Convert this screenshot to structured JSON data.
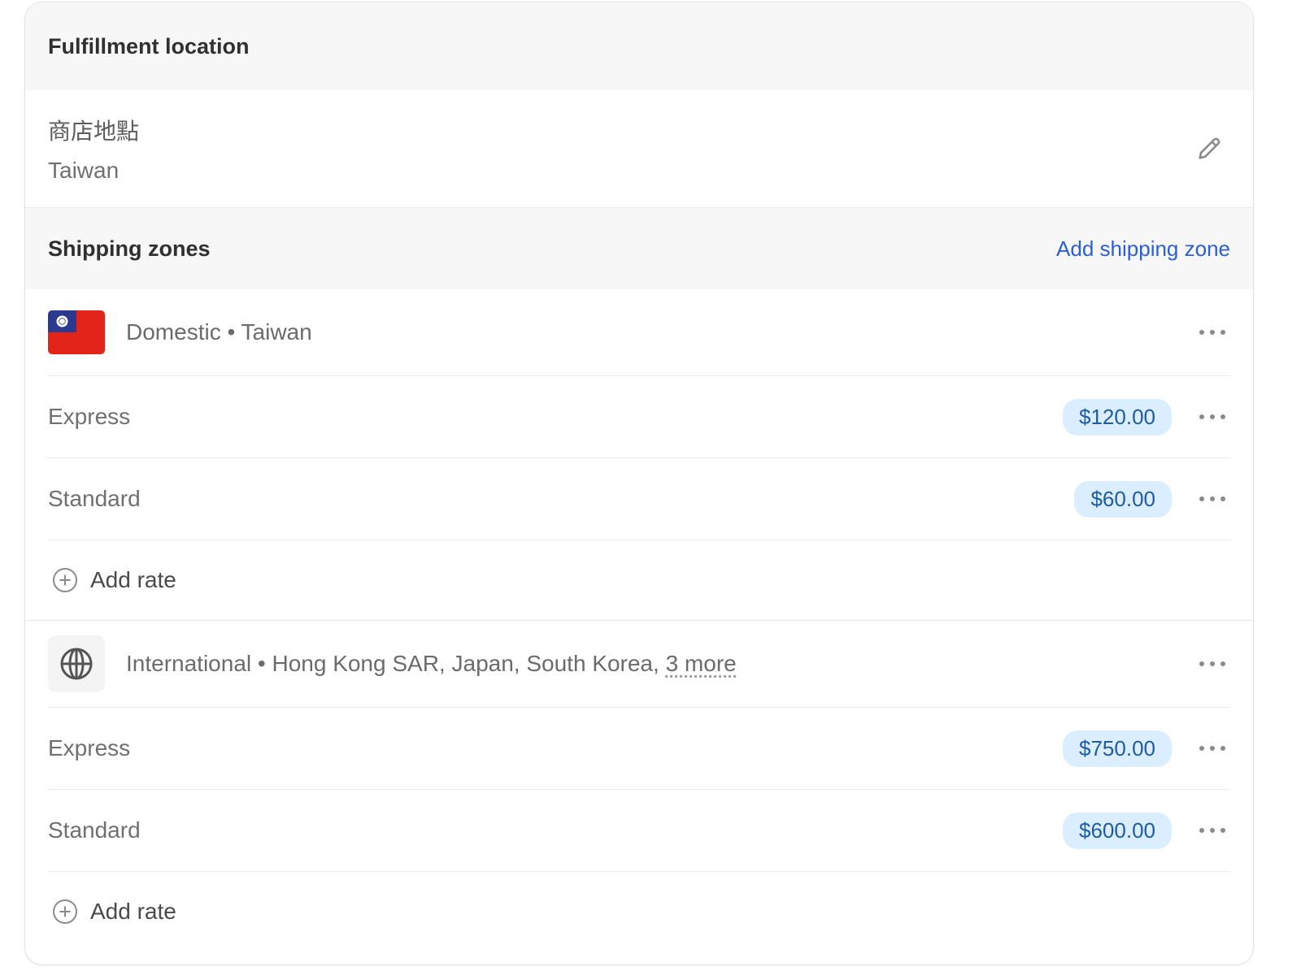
{
  "fulfillment": {
    "title": "Fulfillment location",
    "location_name": "商店地點",
    "location_country": "Taiwan"
  },
  "shipping": {
    "title": "Shipping zones",
    "add_zone_label": "Add shipping zone",
    "zones": [
      {
        "label": "Domestic • Taiwan",
        "icon": "taiwan-flag-icon",
        "rates": [
          {
            "name": "Express",
            "price": "$120.00"
          },
          {
            "name": "Standard",
            "price": "$60.00"
          }
        ],
        "add_rate_label": "Add rate"
      },
      {
        "label": "International • Hong Kong SAR, Japan, South Korea, ",
        "more_label": "3 more",
        "icon": "globe-icon",
        "rates": [
          {
            "name": "Express",
            "price": "$750.00"
          },
          {
            "name": "Standard",
            "price": "$600.00"
          }
        ],
        "add_rate_label": "Add rate"
      }
    ]
  },
  "colors": {
    "link": "#2c5fd6",
    "badge_bg": "#dbeeff",
    "badge_text": "#1f5c9e",
    "header_bg": "#f7f7f7"
  }
}
